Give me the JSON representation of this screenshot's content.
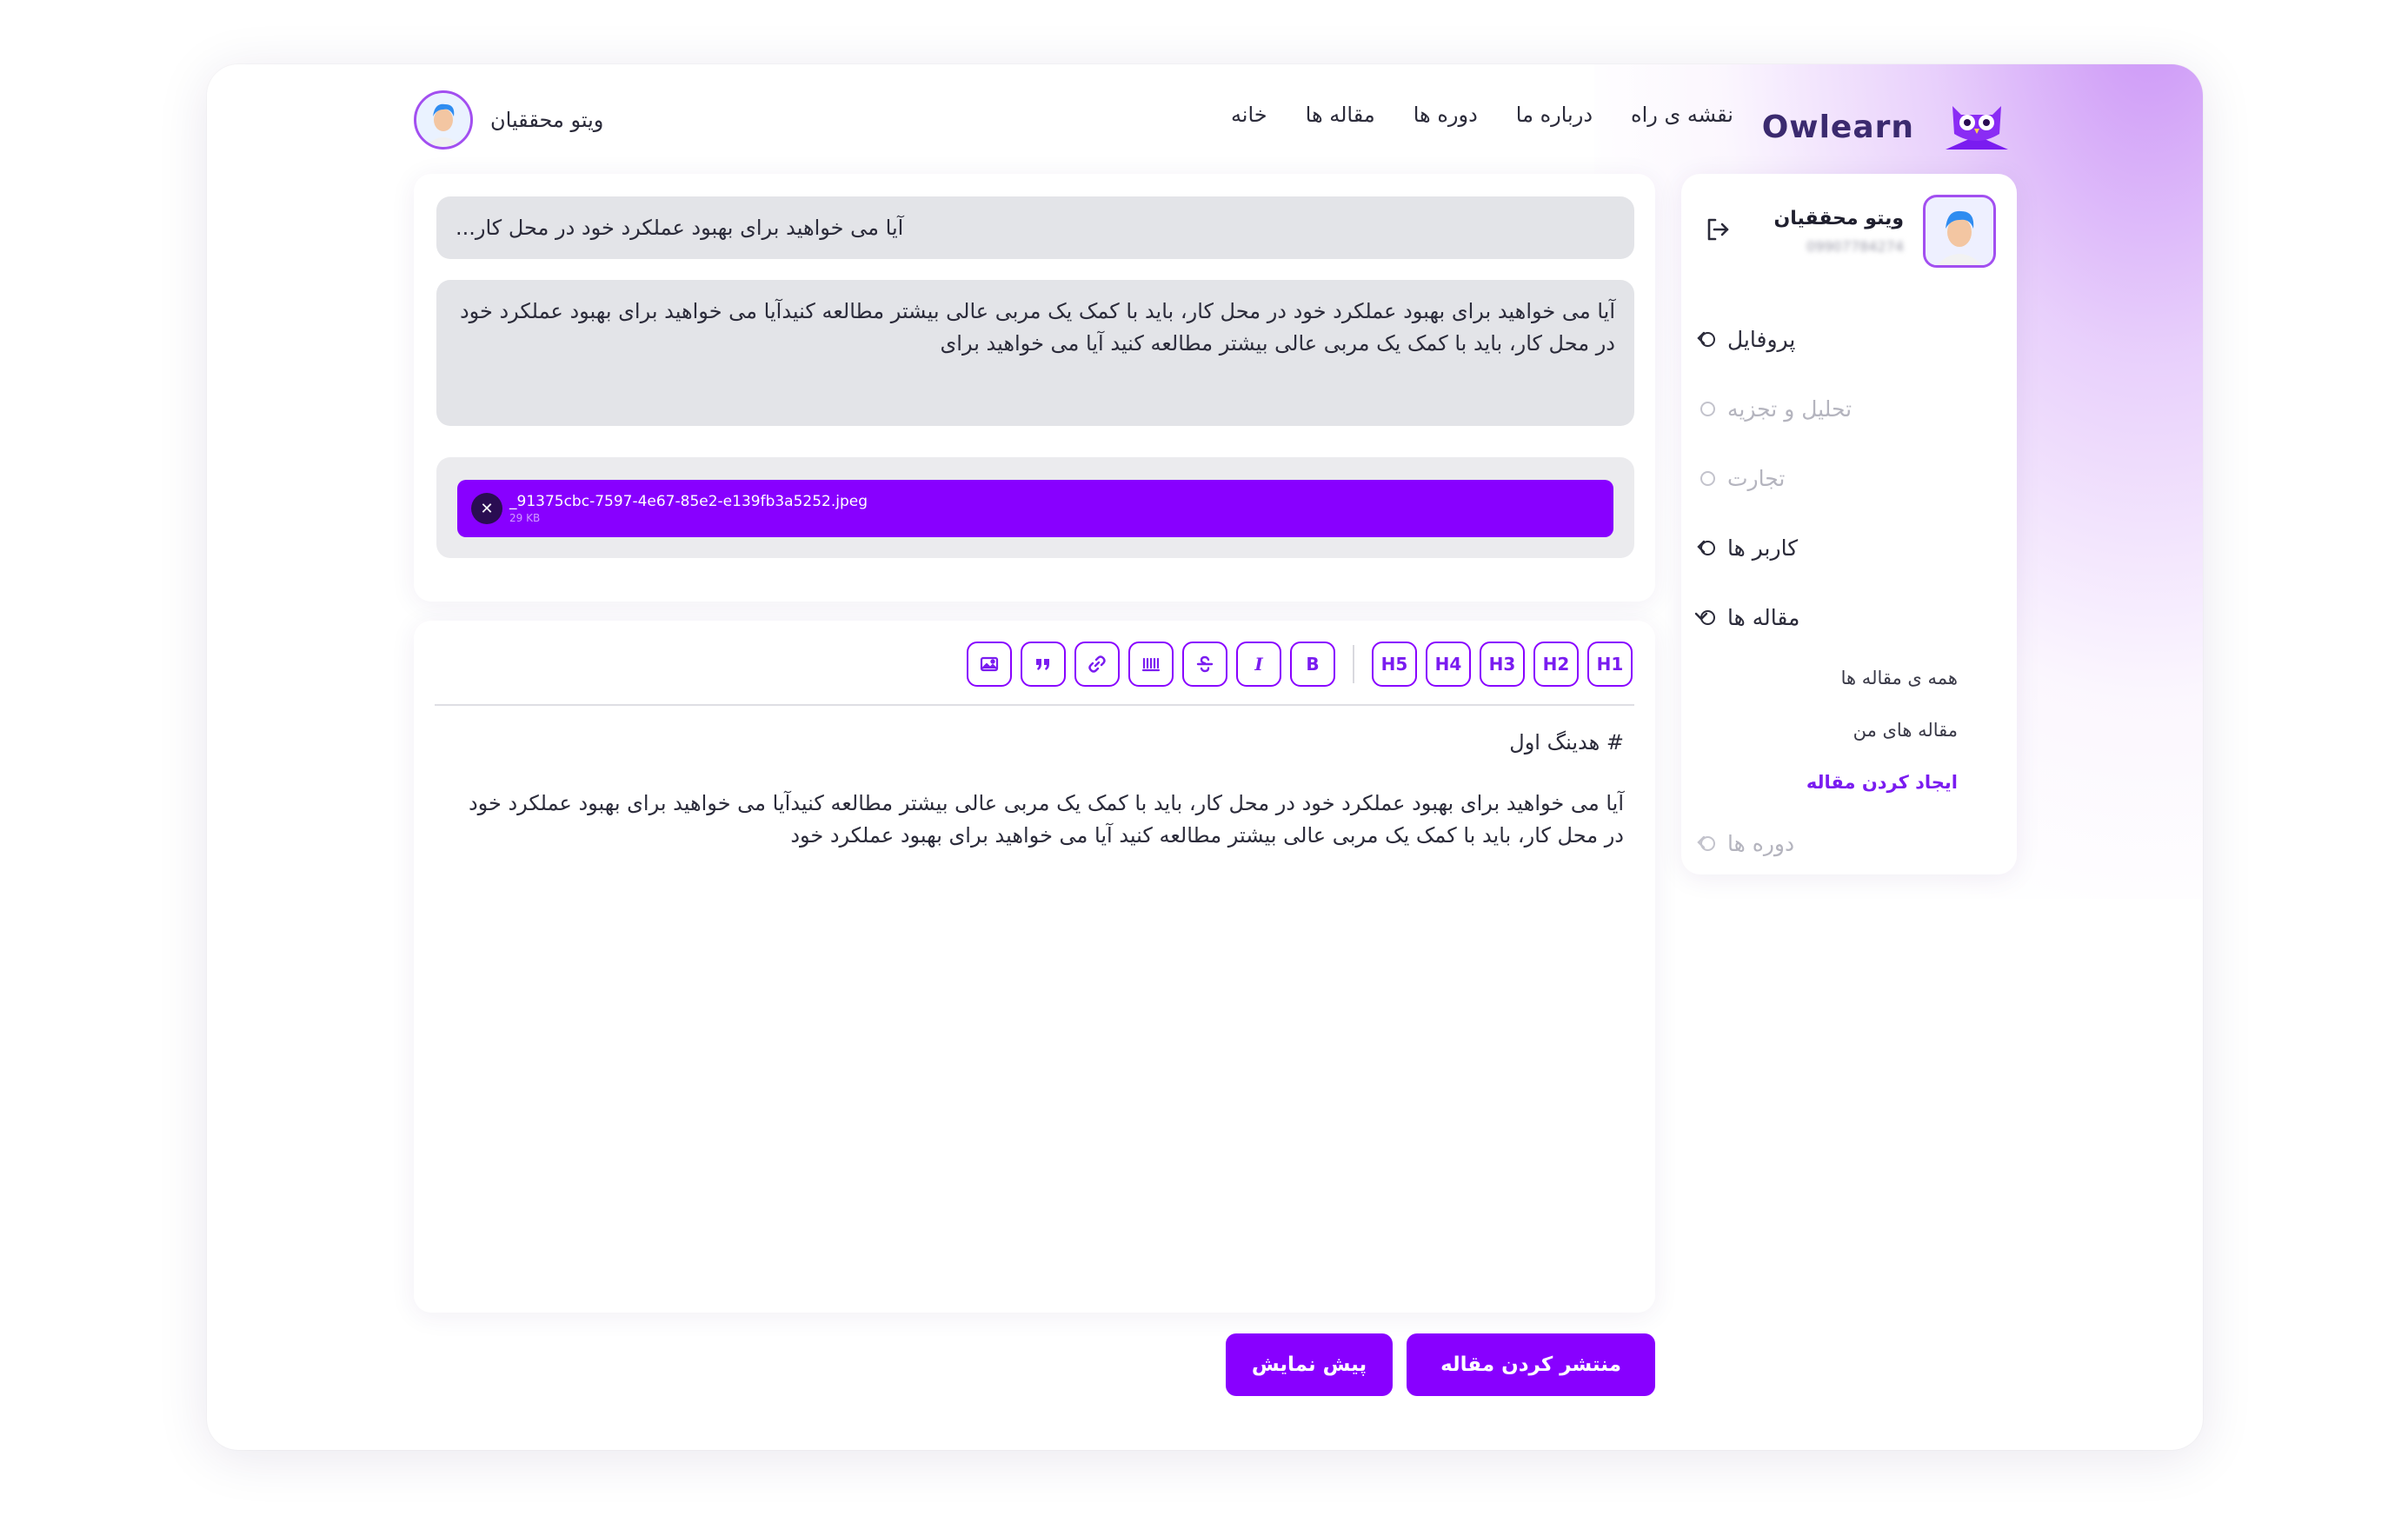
{
  "brand": {
    "name": "Owlearn",
    "accent": "#8800ff",
    "accent_soft": "#a24ff0",
    "text_dark": "#2b2b3a"
  },
  "nav": {
    "items": [
      "خانه",
      "مقاله ها",
      "دوره ها",
      "درباره ما",
      "نقشه ی راه"
    ]
  },
  "header_user": {
    "name": "ویتو محققیان"
  },
  "sidebar": {
    "user_name": "ویتو محققیان",
    "user_phone": "09907784274",
    "menu": [
      {
        "label": "پروفایل",
        "has_chevron": true,
        "enabled": true
      },
      {
        "label": "تحلیل و تجزیه",
        "has_chevron": false,
        "enabled": false
      },
      {
        "label": "تجارت",
        "has_chevron": false,
        "enabled": false
      },
      {
        "label": "کاربر ها",
        "has_chevron": true,
        "enabled": true
      },
      {
        "label": "مقاله ها",
        "has_chevron": true,
        "enabled": true,
        "expanded": true
      },
      {
        "label": "دوره ها",
        "has_chevron": true,
        "enabled": false
      }
    ],
    "submenu": {
      "all_articles": "همه ی مقاله ها",
      "my_articles": "مقاله های من",
      "create_article": "ایجاد کردن مقاله"
    }
  },
  "form": {
    "title_value": "آیا می خواهید برای بهبود عملکرد خود در محل کار...",
    "summary_value": "آیا می خواهید برای بهبود عملکرد خود در محل کار، باید با کمک یک مربی عالی بیشتر مطالعه کنیدآیا می خواهید برای بهبود عملکرد خود در محل کار، باید با کمک یک مربی عالی بیشتر مطالعه کنید آیا می خواهید برای",
    "file": {
      "name": "_91375cbc-7597-4e67-85e2-e139fb3a5252.jpeg",
      "size": "29 KB"
    }
  },
  "editor": {
    "toolbar": {
      "h1": "H1",
      "h2": "H2",
      "h3": "H3",
      "h4": "H4",
      "h5": "H5",
      "bold": "B",
      "italic": "I",
      "icons": [
        "strikethrough-icon",
        "code-icon",
        "link-icon",
        "quote-icon",
        "image-icon"
      ]
    },
    "heading_line": "# هدینگ اول",
    "paragraph": "آیا می خواهید برای بهبود عملکرد خود در محل کار، باید با کمک یک مربی عالی بیشتر مطالعه کنیدآیا می خواهید برای بهبود عملکرد خود در محل کار، باید با کمک یک مربی عالی بیشتر مطالعه کنید آیا می خواهید برای بهبود عملکرد خود"
  },
  "actions": {
    "publish": "منتشر کردن مقاله",
    "preview": "پیش نمایش"
  }
}
